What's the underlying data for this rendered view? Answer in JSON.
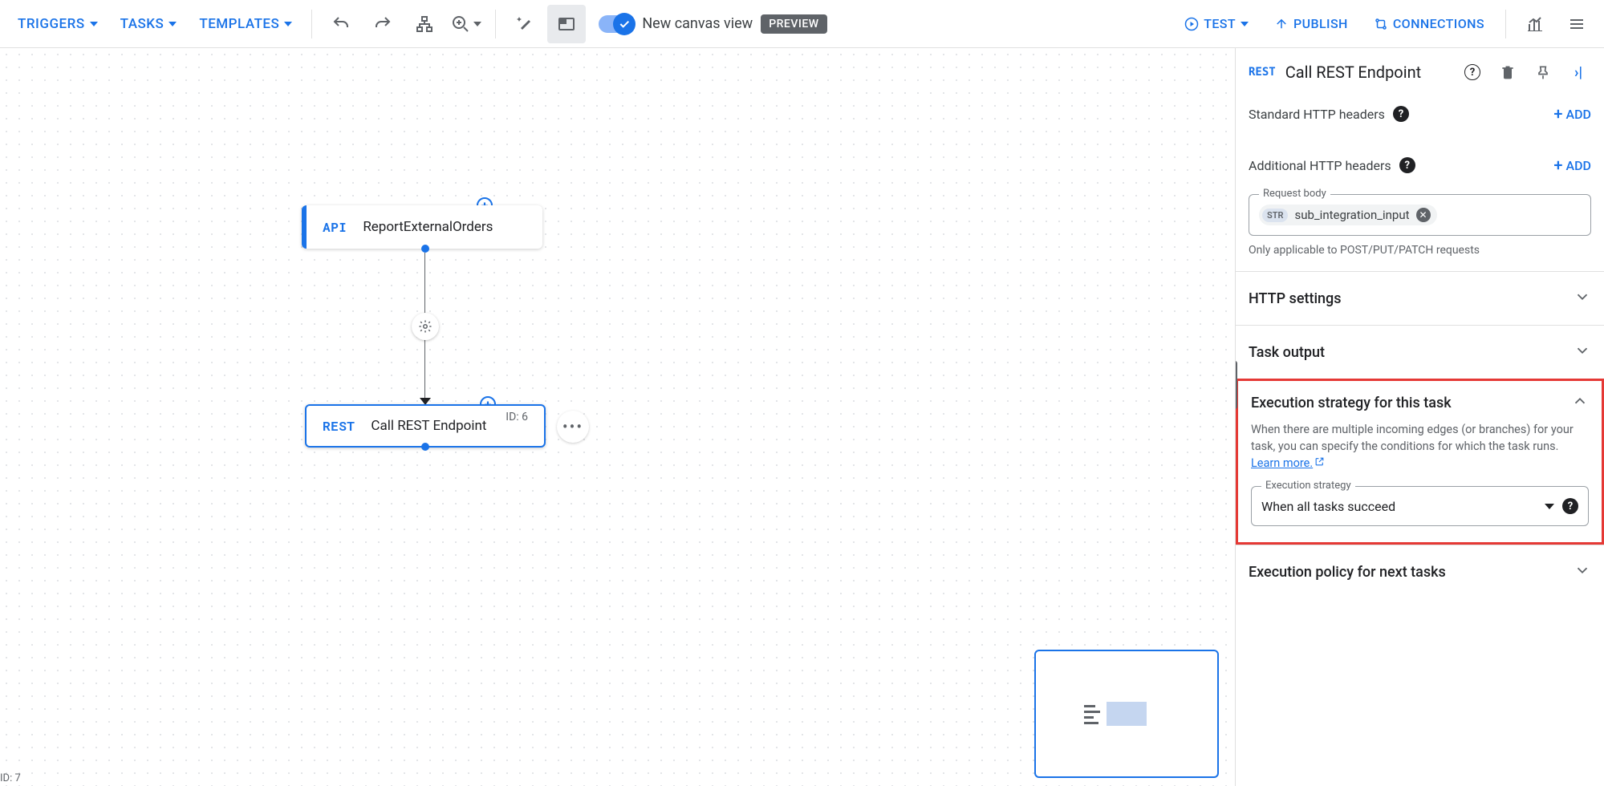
{
  "toolbar": {
    "triggers": "TRIGGERS",
    "tasks": "TASKS",
    "templates": "TEMPLATES",
    "canvas_view": "New canvas view",
    "preview": "PREVIEW",
    "test": "TEST",
    "publish": "PUBLISH",
    "connections": "CONNECTIONS"
  },
  "canvas": {
    "api_tag": "API",
    "api_label": "ReportExternalOrders",
    "rest_tag": "REST",
    "rest_label": "Call REST Endpoint",
    "rest_id": "ID: 6",
    "corner_id": "ID: 7"
  },
  "panel": {
    "tag": "REST",
    "title": "Call REST Endpoint",
    "std_headers": "Standard HTTP headers",
    "addl_headers": "Additional HTTP headers",
    "add": "ADD",
    "req_body_legend": "Request body",
    "req_body_value": "sub_integration_input",
    "req_body_hint": "Only applicable to POST/PUT/PATCH requests",
    "str_tag": "STR",
    "http_settings": "HTTP settings",
    "task_output": "Task output",
    "exec_strategy_title": "Execution strategy for this task",
    "exec_strategy_desc": "When there are multiple incoming edges (or branches) for your task, you can specify the conditions for which the task runs. ",
    "learn_more": "Learn more.",
    "exec_strategy_legend": "Execution strategy",
    "exec_strategy_value": "When all tasks succeed",
    "exec_policy": "Execution policy for next tasks"
  }
}
